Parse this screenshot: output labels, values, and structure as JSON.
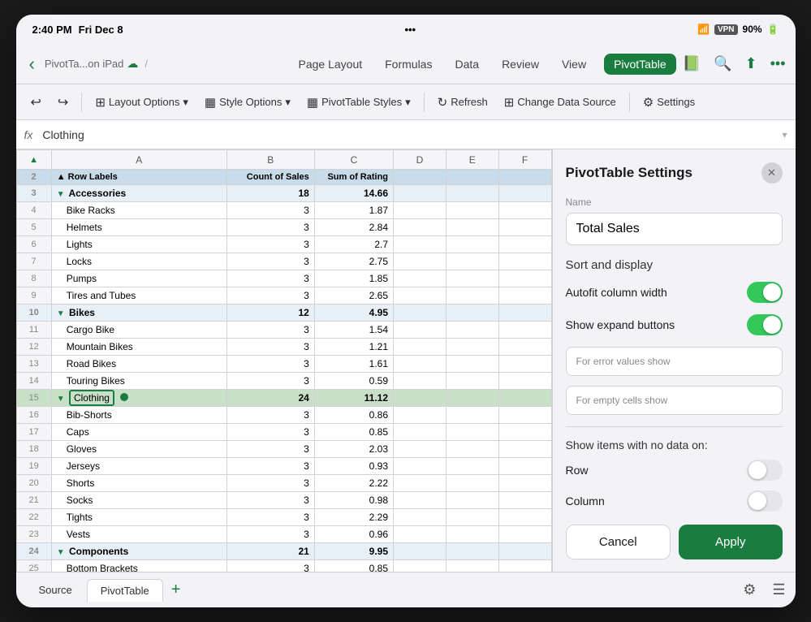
{
  "status": {
    "time": "2:40 PM",
    "date": "Fri Dec 8",
    "wifi": "WiFi",
    "vpn": "VPN",
    "battery": "90%"
  },
  "nav": {
    "back_icon": "‹",
    "title": "PivotTa...on iPad",
    "cloud_icon": "☁",
    "tabs": [
      "Page Layout",
      "Formulas",
      "Data",
      "Review",
      "View",
      "PivotTable"
    ]
  },
  "toolbar": {
    "undo_icon": "↩",
    "redo_icon": "↪",
    "layout_options": "Layout Options",
    "style_options": "Style Options",
    "pivottable_styles": "PivotTable Styles",
    "refresh": "Refresh",
    "change_data_source": "Change Data Source",
    "settings": "Settings"
  },
  "formula_bar": {
    "fx": "fx",
    "value": "Clothing"
  },
  "spreadsheet": {
    "col_headers": [
      "",
      "A",
      "B",
      "C",
      "D",
      "E",
      "F"
    ],
    "rows": [
      {
        "num": "2",
        "type": "pivot_header",
        "cells": [
          "Row Labels",
          "Count of Sales",
          "Sum of Rating",
          "",
          "",
          ""
        ]
      },
      {
        "num": "3",
        "type": "category",
        "cells": [
          "Accessories",
          "18",
          "14.66",
          "",
          "",
          ""
        ]
      },
      {
        "num": "4",
        "type": "data",
        "cells": [
          "Bike Racks",
          "3",
          "1.87",
          "",
          "",
          ""
        ]
      },
      {
        "num": "5",
        "type": "data",
        "cells": [
          "Helmets",
          "3",
          "2.84",
          "",
          "",
          ""
        ]
      },
      {
        "num": "6",
        "type": "data",
        "cells": [
          "Lights",
          "3",
          "2.7",
          "",
          "",
          ""
        ]
      },
      {
        "num": "7",
        "type": "data",
        "cells": [
          "Locks",
          "3",
          "2.75",
          "",
          "",
          ""
        ]
      },
      {
        "num": "8",
        "type": "data",
        "cells": [
          "Pumps",
          "3",
          "1.85",
          "",
          "",
          ""
        ]
      },
      {
        "num": "9",
        "type": "data",
        "cells": [
          "Tires and Tubes",
          "3",
          "2.65",
          "",
          "",
          ""
        ]
      },
      {
        "num": "10",
        "type": "category",
        "cells": [
          "Bikes",
          "12",
          "4.95",
          "",
          "",
          ""
        ]
      },
      {
        "num": "11",
        "type": "data",
        "cells": [
          "Cargo Bike",
          "3",
          "1.54",
          "",
          "",
          ""
        ]
      },
      {
        "num": "12",
        "type": "data",
        "cells": [
          "Mountain Bikes",
          "3",
          "1.21",
          "",
          "",
          ""
        ]
      },
      {
        "num": "13",
        "type": "data",
        "cells": [
          "Road Bikes",
          "3",
          "1.61",
          "",
          "",
          ""
        ]
      },
      {
        "num": "14",
        "type": "data",
        "cells": [
          "Touring Bikes",
          "3",
          "0.59",
          "",
          "",
          ""
        ]
      },
      {
        "num": "15",
        "type": "selected_category",
        "cells": [
          "Clothing",
          "24",
          "11.12",
          "",
          "",
          ""
        ]
      },
      {
        "num": "16",
        "type": "data",
        "cells": [
          "Bib-Shorts",
          "3",
          "0.86",
          "",
          "",
          ""
        ]
      },
      {
        "num": "17",
        "type": "data",
        "cells": [
          "Caps",
          "3",
          "0.85",
          "",
          "",
          ""
        ]
      },
      {
        "num": "18",
        "type": "data",
        "cells": [
          "Gloves",
          "3",
          "2.03",
          "",
          "",
          ""
        ]
      },
      {
        "num": "19",
        "type": "data",
        "cells": [
          "Jerseys",
          "3",
          "0.93",
          "",
          "",
          ""
        ]
      },
      {
        "num": "20",
        "type": "data",
        "cells": [
          "Shorts",
          "3",
          "2.22",
          "",
          "",
          ""
        ]
      },
      {
        "num": "21",
        "type": "data",
        "cells": [
          "Socks",
          "3",
          "0.98",
          "",
          "",
          ""
        ]
      },
      {
        "num": "22",
        "type": "data",
        "cells": [
          "Tights",
          "3",
          "2.29",
          "",
          "",
          ""
        ]
      },
      {
        "num": "23",
        "type": "data",
        "cells": [
          "Vests",
          "3",
          "0.96",
          "",
          "",
          ""
        ]
      },
      {
        "num": "24",
        "type": "category",
        "cells": [
          "Components",
          "21",
          "9.95",
          "",
          "",
          ""
        ]
      },
      {
        "num": "25",
        "type": "data",
        "cells": [
          "Bottom Brackets",
          "3",
          "0.85",
          "",
          "",
          ""
        ]
      }
    ]
  },
  "panel": {
    "title": "PivotTable Settings",
    "close_icon": "✕",
    "name_label": "Name",
    "name_value": "Total Sales",
    "sort_display_heading": "Sort and display",
    "autofit_label": "Autofit column width",
    "autofit_on": true,
    "expand_btns_label": "Show expand buttons",
    "expand_btns_on": true,
    "error_label": "For error values show",
    "empty_label": "For empty cells show",
    "no_data_label": "Show items with no data on:",
    "row_label": "Row",
    "row_on": false,
    "column_label": "Column",
    "column_on": false,
    "cancel_label": "Cancel",
    "apply_label": "Apply"
  },
  "bottom_tabs": {
    "source": "Source",
    "pivottable": "PivotTable",
    "add_icon": "+"
  }
}
